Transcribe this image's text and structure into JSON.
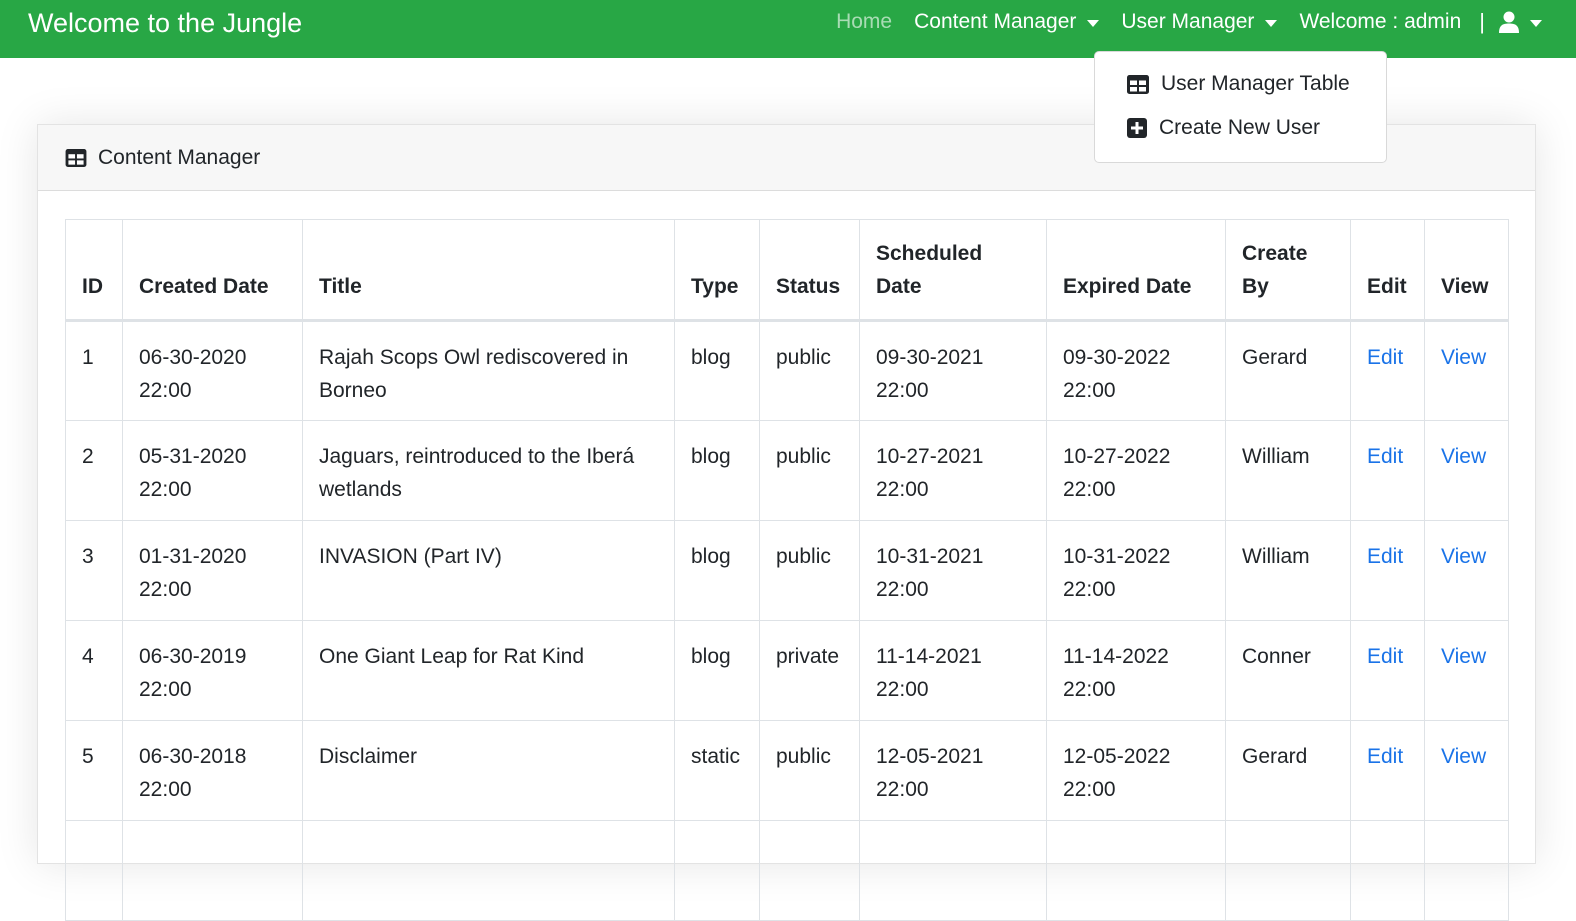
{
  "navbar": {
    "brand": "Welcome to the Jungle",
    "home": "Home",
    "content_manager": "Content Manager",
    "user_manager": "User Manager",
    "welcome": "Welcome : admin",
    "separator": "|",
    "accent_color": "#28a745"
  },
  "dropdown": {
    "items": [
      {
        "label": "User Manager Table",
        "icon": "table-icon"
      },
      {
        "label": "Create New User",
        "icon": "plus-square-icon"
      }
    ]
  },
  "card": {
    "title": "Content Manager",
    "icon": "table-icon"
  },
  "table": {
    "headers": {
      "id": "ID",
      "created": "Created Date",
      "title": "Title",
      "type": "Type",
      "status": "Status",
      "scheduled_1": "Scheduled",
      "scheduled_2": "Date",
      "expired": "Expired Date",
      "create_by_1": "Create",
      "create_by_2": "By",
      "edit": "Edit",
      "view": "View"
    },
    "rows": [
      {
        "id": "1",
        "created_date": "06-30-2020",
        "created_time": "22:00",
        "title": "Rajah Scops Owl rediscovered in Borneo",
        "type": "blog",
        "status": "public",
        "sched_date": "09-30-2021",
        "sched_time": "22:00",
        "exp_date": "09-30-2022",
        "exp_time": "22:00",
        "create_by": "Gerard",
        "edit": "Edit",
        "view": "View"
      },
      {
        "id": "2",
        "created_date": "05-31-2020",
        "created_time": "22:00",
        "title": "Jaguars, reintroduced to the Iberá wetlands",
        "type": "blog",
        "status": "public",
        "sched_date": "10-27-2021",
        "sched_time": "22:00",
        "exp_date": "10-27-2022",
        "exp_time": "22:00",
        "create_by": "William",
        "edit": "Edit",
        "view": "View"
      },
      {
        "id": "3",
        "created_date": "01-31-2020",
        "created_time": "22:00",
        "title": "INVASION (Part IV)",
        "type": "blog",
        "status": "public",
        "sched_date": "10-31-2021",
        "sched_time": "22:00",
        "exp_date": "10-31-2022",
        "exp_time": "22:00",
        "create_by": "William",
        "edit": "Edit",
        "view": "View"
      },
      {
        "id": "4",
        "created_date": "06-30-2019",
        "created_time": "22:00",
        "title": "One Giant Leap for Rat Kind",
        "type": "blog",
        "status": "private",
        "sched_date": "11-14-2021",
        "sched_time": "22:00",
        "exp_date": "11-14-2022",
        "exp_time": "22:00",
        "create_by": "Conner",
        "edit": "Edit",
        "view": "View"
      },
      {
        "id": "5",
        "created_date": "06-30-2018",
        "created_time": "22:00",
        "title": "Disclaimer",
        "type": "static",
        "status": "public",
        "sched_date": "12-05-2021",
        "sched_time": "22:00",
        "exp_date": "12-05-2022",
        "exp_time": "22:00",
        "create_by": "Gerard",
        "edit": "Edit",
        "view": "View"
      }
    ],
    "link_color": "#1a73e8"
  }
}
